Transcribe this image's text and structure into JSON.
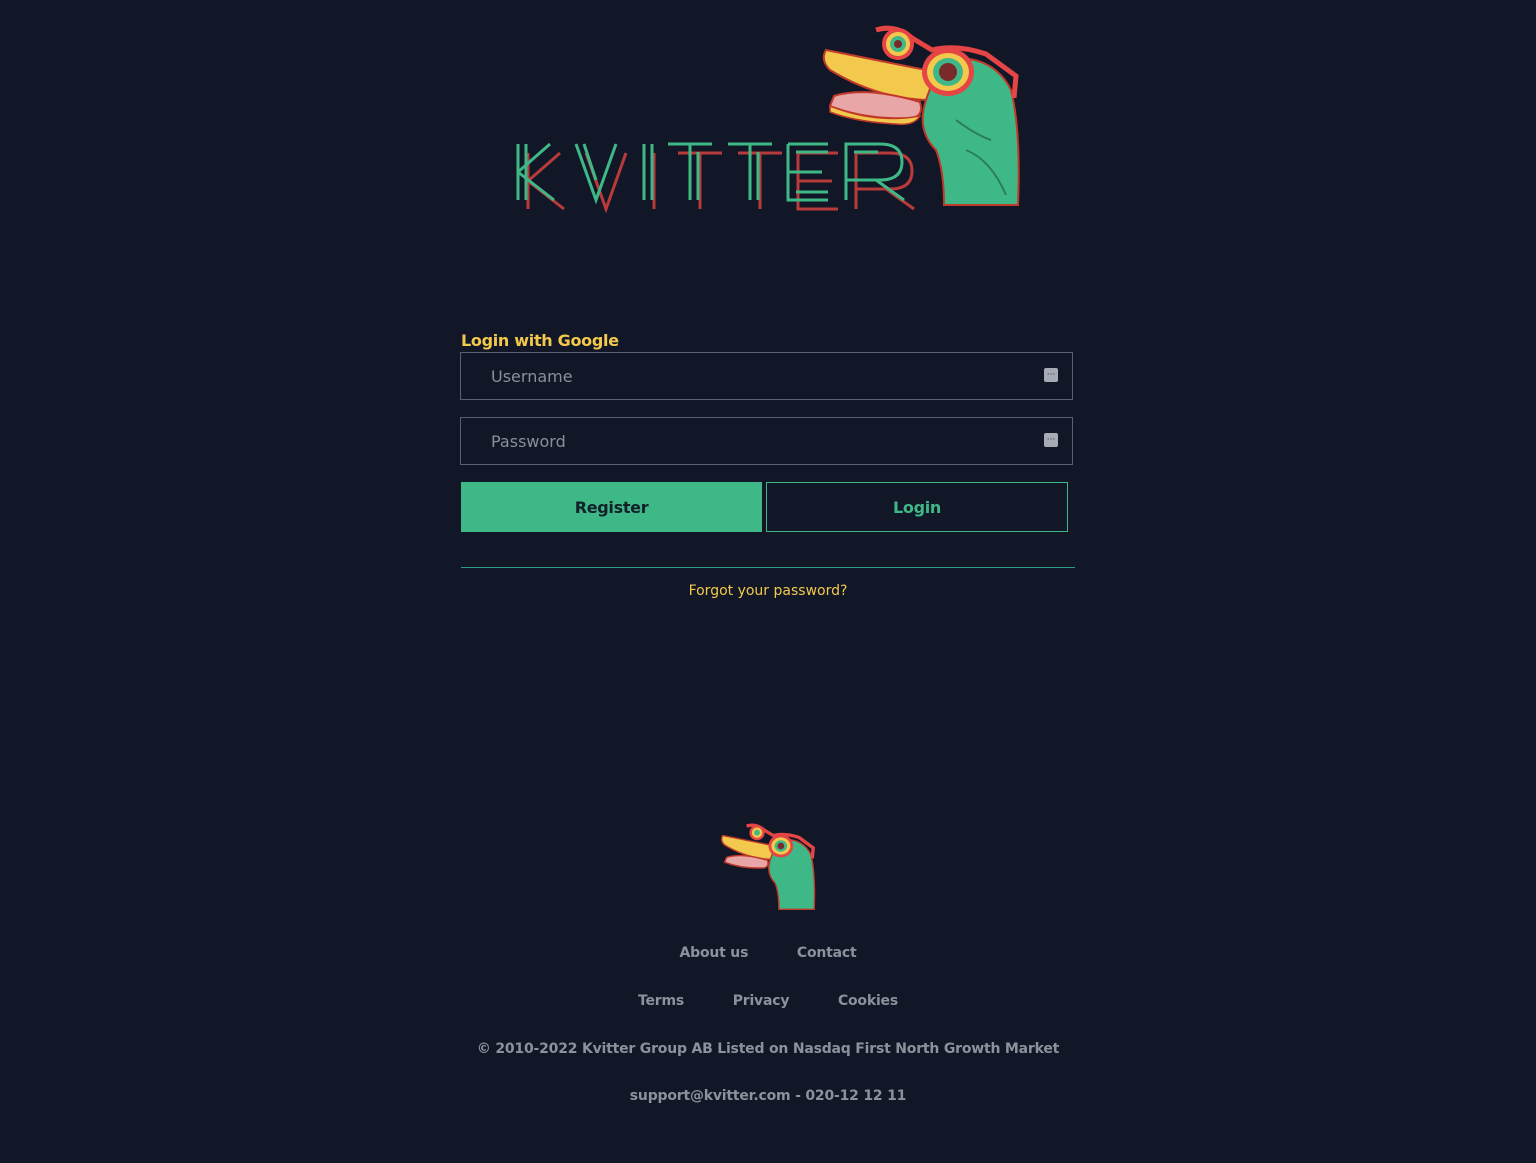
{
  "brand": {
    "wordmark": "KVITTER",
    "colors": {
      "background": "#111726",
      "accent_green": "#3fb888",
      "accent_yellow": "#f2c94c",
      "wordmark_red": "#c0392b"
    }
  },
  "form": {
    "google_link": "Login with Google",
    "username_placeholder": "Username",
    "password_placeholder": "Password",
    "password_manager_icon": "password-manager-icon",
    "register_label": "Register",
    "login_label": "Login",
    "forgot_label": "Forgot your password?"
  },
  "footer": {
    "links_row1": [
      "About us",
      "Contact"
    ],
    "links_row2": [
      "Terms",
      "Privacy",
      "Cookies"
    ],
    "copyright": "© 2010-2022 Kvitter Group AB Listed on Nasdaq First North Growth Market",
    "contact_line": "support@kvitter.com - 020-12 12 11"
  }
}
